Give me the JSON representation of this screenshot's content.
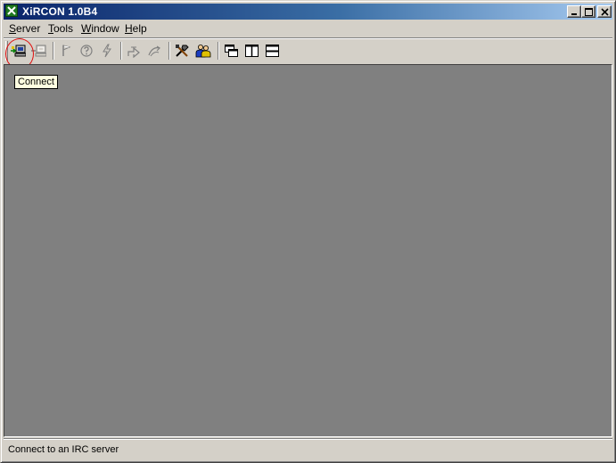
{
  "window": {
    "title": "XiRCON 1.0B4",
    "app_icon": "xircon-x-icon",
    "title_colors": {
      "active_start": "#0a246a",
      "active_end": "#a6caf0"
    }
  },
  "menu": {
    "items": [
      {
        "label": "Server",
        "accel": "S"
      },
      {
        "label": "Tools",
        "accel": "T"
      },
      {
        "label": "Window",
        "accel": "W"
      },
      {
        "label": "Help",
        "accel": "H"
      }
    ]
  },
  "toolbar": {
    "buttons": [
      {
        "icon": "connect-icon",
        "enabled": true
      },
      {
        "icon": "disconnect-icon",
        "enabled": false
      },
      {
        "icon": "flag-icon",
        "enabled": false
      },
      {
        "icon": "question-icon",
        "enabled": false
      },
      {
        "icon": "lightning-icon",
        "enabled": false
      },
      {
        "icon": "join-channel-icon",
        "enabled": false
      },
      {
        "icon": "part-channel-icon",
        "enabled": false
      },
      {
        "icon": "tools-icon",
        "enabled": true
      },
      {
        "icon": "users-icon",
        "enabled": true
      },
      {
        "icon": "cascade-windows-icon",
        "enabled": true
      },
      {
        "icon": "tile-vertical-icon",
        "enabled": true
      },
      {
        "icon": "tile-horizontal-icon",
        "enabled": true
      }
    ],
    "highlight_color": "#e01010"
  },
  "tooltip": {
    "text": "Connect"
  },
  "mdi_background": "#808080",
  "status": {
    "text": "Connect to an IRC server"
  }
}
